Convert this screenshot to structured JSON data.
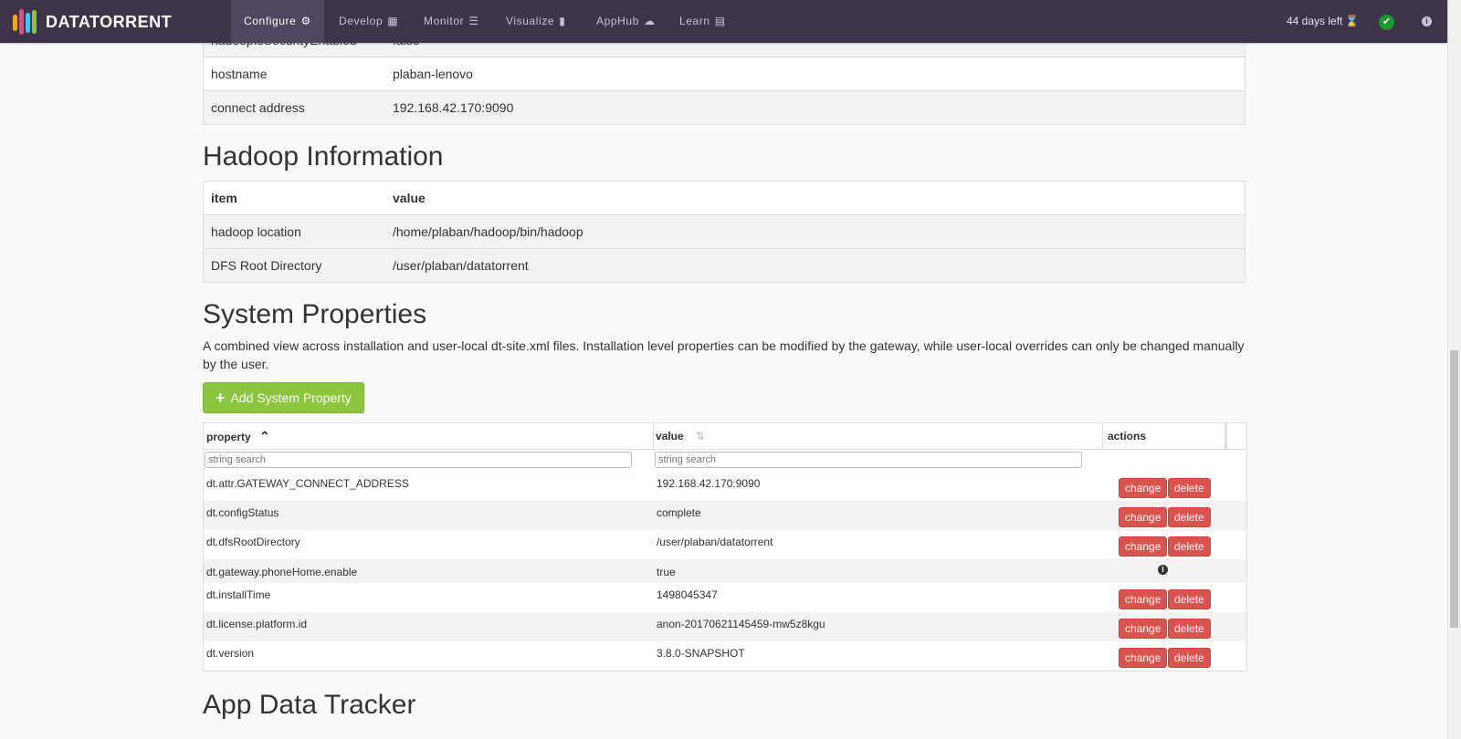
{
  "nav": {
    "brand": "DATATORRENT",
    "items": [
      {
        "label": "Configure",
        "icon": "⚙"
      },
      {
        "label": "Develop",
        "icon": "▦"
      },
      {
        "label": "Monitor",
        "icon": "☰"
      },
      {
        "label": "Visualize",
        "icon": "▮"
      },
      {
        "label": "AppHub",
        "icon": "☁"
      },
      {
        "label": "Learn",
        "icon": "▤"
      }
    ],
    "days_left": "44 days left",
    "hourglass_icon": "⌛",
    "status_icon": "✔",
    "info_icon": "i"
  },
  "gateway_table": {
    "rows": [
      {
        "item": "hadoopIsSecurityEnabled",
        "value": "false"
      },
      {
        "item": "hostname",
        "value": "plaban-lenovo"
      },
      {
        "item": "connect address",
        "value": "192.168.42.170:9090"
      }
    ]
  },
  "hadoop": {
    "title": "Hadoop Information",
    "headers": {
      "item": "item",
      "value": "value"
    },
    "rows": [
      {
        "item": "hadoop location",
        "value": "/home/plaban/hadoop/bin/hadoop"
      },
      {
        "item": "DFS Root Directory",
        "value": "/user/plaban/datatorrent"
      }
    ]
  },
  "system": {
    "title": "System Properties",
    "description": "A combined view across installation and user-local dt-site.xml files. Installation level properties can be modified by the gateway, while user-local overrides can only be changed manually by the user.",
    "add_button": "Add System Property",
    "headers": {
      "property": "property",
      "value": "value",
      "actions": "actions"
    },
    "sort_asc_icon": "⌃",
    "sort_both_icon": "⇅",
    "filter_placeholder": "string search",
    "change_label": "change",
    "delete_label": "delete",
    "rows": [
      {
        "property": "dt.attr.GATEWAY_CONNECT_ADDRESS",
        "value": "192.168.42.170:9090",
        "editable": true
      },
      {
        "property": "dt.configStatus",
        "value": "complete",
        "editable": true
      },
      {
        "property": "dt.dfsRootDirectory",
        "value": "/user/plaban/datatorrent",
        "editable": true
      },
      {
        "property": "dt.gateway.phoneHome.enable",
        "value": "true",
        "editable": false
      },
      {
        "property": "dt.installTime",
        "value": "1498045347",
        "editable": true
      },
      {
        "property": "dt.license.platform.id",
        "value": "anon-20170621145459-mw5z8kgu",
        "editable": true
      },
      {
        "property": "dt.version",
        "value": "3.8.0-SNAPSHOT",
        "editable": true
      }
    ]
  },
  "app_data_tracker": {
    "title": "App Data Tracker"
  },
  "colors": {
    "navbar": "#3d344a",
    "add_button": "#8cc63f",
    "danger": "#d9534f"
  }
}
